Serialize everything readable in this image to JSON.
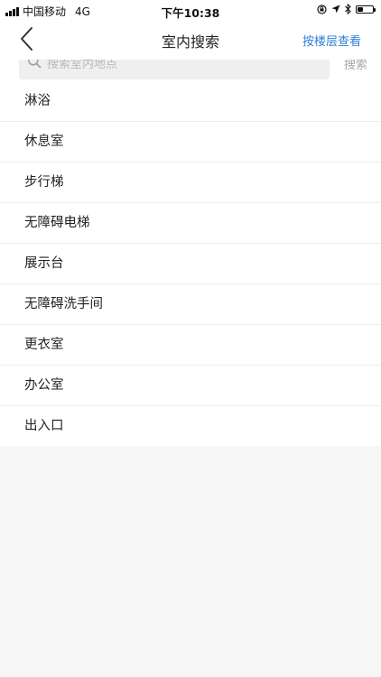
{
  "status_bar": {
    "carrier": "中国移动",
    "network": "4G",
    "time": "下午10:38",
    "battery_level": 0.35
  },
  "nav": {
    "title": "室内搜索",
    "right_action": "按楼层查看"
  },
  "search": {
    "placeholder": "搜索室内地点",
    "value": "",
    "button_label": "搜索"
  },
  "places": [
    {
      "label": "淋浴"
    },
    {
      "label": "休息室"
    },
    {
      "label": "步行梯"
    },
    {
      "label": "无障碍电梯"
    },
    {
      "label": "展示台"
    },
    {
      "label": "无障碍洗手间"
    },
    {
      "label": "更衣室"
    },
    {
      "label": "办公室"
    },
    {
      "label": "出入口"
    }
  ],
  "colors": {
    "accent": "#2f80d8",
    "background": "#f7f6f7",
    "surface": "#ffffff"
  }
}
